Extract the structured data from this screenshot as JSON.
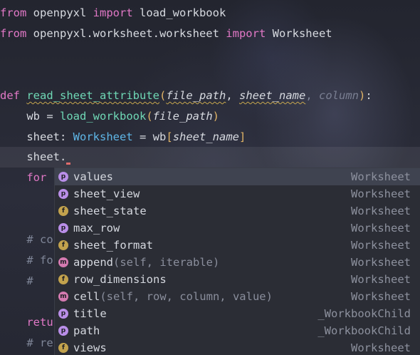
{
  "colors": {
    "keyword": "#e178c6",
    "function": "#6fd8b5",
    "class": "#5fb7e8",
    "bracket": "#e1b466",
    "popup_bg": "#2b2d35",
    "selection": "#3f4350"
  },
  "code": {
    "line1": {
      "kw1": "from",
      "mod": " openpyxl ",
      "kw2": "import",
      "name": " load_workbook"
    },
    "line2": {
      "kw1": "from",
      "mod": " openpyxl.worksheet.worksheet ",
      "kw2": "import",
      "name": " Worksheet"
    },
    "line3": {
      "kw": "def",
      "fname": "read_sheet_attribute",
      "open": "(",
      "p1": "file_path",
      "sep1": ", ",
      "p2": "sheet_name",
      "sep2": ", ",
      "p3": "column",
      "close": ")",
      "colon": ":"
    },
    "line4": {
      "indent": "    ",
      "var": "wb",
      "eq": " = ",
      "call": "load_workbook",
      "open": "(",
      "arg": "file_path",
      "close": ")"
    },
    "line5": {
      "indent": "    ",
      "var": "sheet",
      "colon": ": ",
      "type": "Worksheet",
      "eq": " = wb",
      "open": "[",
      "arg": "sheet_name",
      "close": "]"
    },
    "line6": {
      "indent": "    ",
      "text": "sheet."
    },
    "line7": {
      "indent": "    ",
      "text": "for"
    },
    "line8": {
      "indent": "    ",
      "text": "# co"
    },
    "line9": {
      "indent": "    ",
      "text": "# fo"
    },
    "line10": {
      "indent": "    ",
      "text": "#"
    },
    "line11": {
      "indent": "    ",
      "text": "retu"
    },
    "line12": {
      "indent": "    ",
      "text": "# re"
    }
  },
  "completion": {
    "items": [
      {
        "icon": "p",
        "icon_name": "property-icon",
        "name": "values",
        "sig": "",
        "type": "Worksheet"
      },
      {
        "icon": "p",
        "icon_name": "property-icon",
        "name": "sheet_view",
        "sig": "",
        "type": "Worksheet"
      },
      {
        "icon": "f",
        "icon_name": "field-icon",
        "name": "sheet_state",
        "sig": "",
        "type": "Worksheet"
      },
      {
        "icon": "p",
        "icon_name": "property-icon",
        "name": "max_row",
        "sig": "",
        "type": "Worksheet"
      },
      {
        "icon": "f",
        "icon_name": "field-icon",
        "name": "sheet_format",
        "sig": "",
        "type": "Worksheet"
      },
      {
        "icon": "m",
        "icon_name": "method-icon",
        "name": "append",
        "sig": "(self, iterable)",
        "type": "Worksheet"
      },
      {
        "icon": "f",
        "icon_name": "field-icon",
        "name": "row_dimensions",
        "sig": "",
        "type": "Worksheet"
      },
      {
        "icon": "m",
        "icon_name": "method-icon",
        "name": "cell",
        "sig": "(self, row, column, value)",
        "type": "Worksheet"
      },
      {
        "icon": "p",
        "icon_name": "property-icon",
        "name": "title",
        "sig": "",
        "type": "_WorkbookChild"
      },
      {
        "icon": "p",
        "icon_name": "property-icon",
        "name": "path",
        "sig": "",
        "type": "_WorkbookChild"
      },
      {
        "icon": "f",
        "icon_name": "field-icon",
        "name": "views",
        "sig": "",
        "type": "Worksheet"
      }
    ]
  }
}
